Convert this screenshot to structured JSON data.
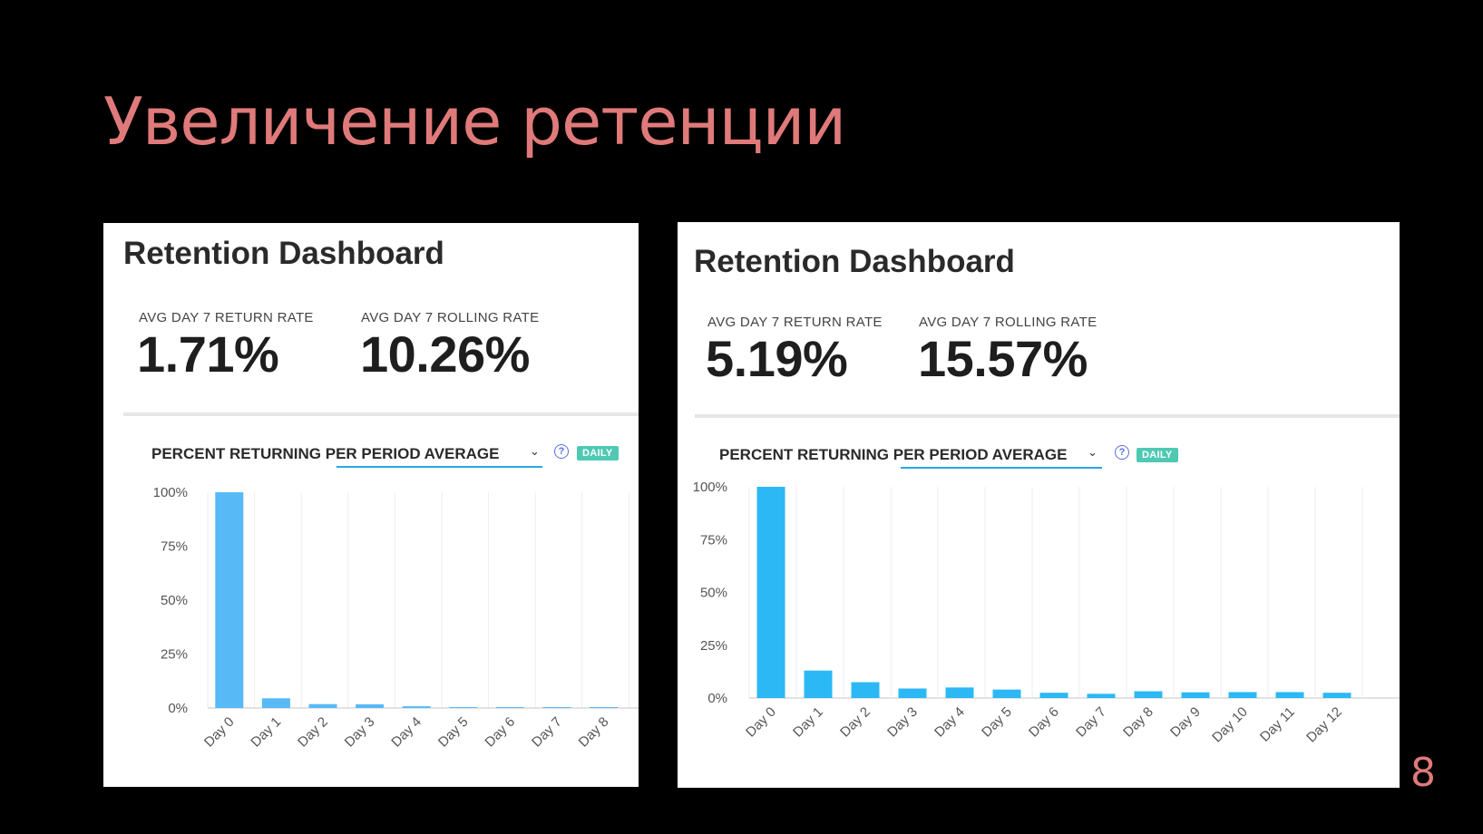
{
  "slide": {
    "title": "Увеличение ретенции",
    "page_number": "8",
    "title_color": "#e07a7a"
  },
  "dashboards": [
    {
      "title": "Retention Dashboard",
      "metrics": [
        {
          "label": "AVG DAY 7 RETURN RATE",
          "value": "1.71%"
        },
        {
          "label": "AVG DAY 7 ROLLING RATE",
          "value": "10.26%"
        }
      ],
      "chart_header": {
        "prefix": "PERCENT RETURNING ",
        "selector": "PER PERIOD AVERAGE",
        "help": "?",
        "badge": "DAILY"
      }
    },
    {
      "title": "Retention Dashboard",
      "metrics": [
        {
          "label": "AVG DAY 7 RETURN RATE",
          "value": "5.19%"
        },
        {
          "label": "AVG DAY 7 ROLLING RATE",
          "value": "15.57%"
        }
      ],
      "chart_header": {
        "prefix": "PERCENT RETURNING ",
        "selector": "PER PERIOD AVERAGE",
        "help": "?",
        "badge": "DAILY"
      }
    }
  ],
  "chart_data": [
    {
      "type": "bar",
      "title": "",
      "xlabel": "",
      "ylabel": "",
      "categories": [
        "Day 0",
        "Day 1",
        "Day 2",
        "Day 3",
        "Day 4",
        "Day 5",
        "Day 6",
        "Day 7",
        "Day 8"
      ],
      "values": [
        100,
        4.5,
        1.8,
        1.7,
        0.8,
        0.3,
        0.3,
        0.2,
        0.1
      ],
      "ylim": [
        0,
        100
      ],
      "yticks": [
        "100%",
        "75%",
        "50%",
        "25%",
        "0%"
      ],
      "ytick_values": [
        100,
        75,
        50,
        25,
        0
      ],
      "color": "#57b9f5",
      "grid": true
    },
    {
      "type": "bar",
      "title": "",
      "xlabel": "",
      "ylabel": "",
      "categories": [
        "Day 0",
        "Day 1",
        "Day 2",
        "Day 3",
        "Day 4",
        "Day 5",
        "Day 6",
        "Day 7",
        "Day 8",
        "Day 9",
        "Day 10",
        "Day 11",
        "Day 12"
      ],
      "values": [
        100,
        13,
        7.5,
        4.5,
        5,
        4,
        2.5,
        2,
        3.2,
        2.7,
        2.8,
        2.8,
        2.5
      ],
      "ylim": [
        0,
        100
      ],
      "yticks": [
        "100%",
        "75%",
        "50%",
        "25%",
        "0%"
      ],
      "ytick_values": [
        100,
        75,
        50,
        25,
        0
      ],
      "color": "#2bb8f5",
      "grid": true
    }
  ]
}
